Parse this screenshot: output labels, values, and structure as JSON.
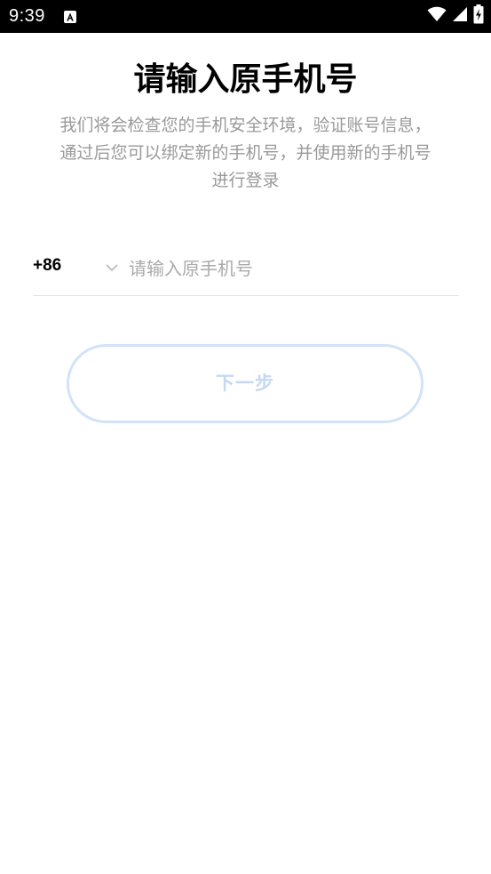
{
  "status_bar": {
    "time": "9:39",
    "icons": [
      "accessibility-a-icon",
      "wifi-icon",
      "cellular-signal-icon",
      "battery-charging-icon"
    ]
  },
  "page": {
    "title": "请输入原手机号",
    "subtitle_lines": [
      "我们将会检查您的手机安全环境，验证账号信息，",
      "通过后您可以绑定新的手机号，并使用新的手机号",
      "进行登录"
    ]
  },
  "phone_form": {
    "country_code": "+86",
    "phone_placeholder": "请输入原手机号",
    "phone_value": ""
  },
  "next_button": {
    "label": "下一步",
    "enabled": false
  },
  "colors": {
    "status_bar_bg": "#000000",
    "title": "#000000",
    "subtitle": "#999999",
    "placeholder": "#aaaaaa",
    "divider": "#e3e3e3",
    "button_border": "#d2e2f8",
    "button_text": "#c5d8f3"
  }
}
